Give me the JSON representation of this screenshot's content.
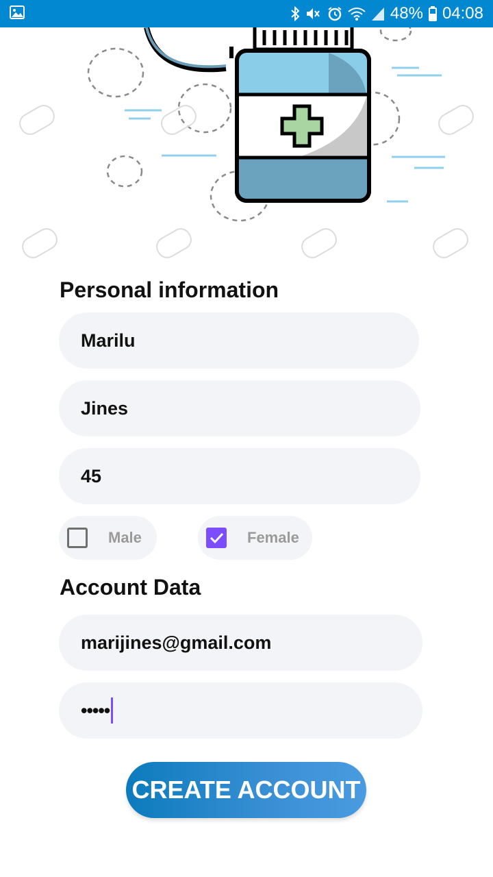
{
  "status_bar": {
    "battery_percent": "48%",
    "time": "04:08",
    "icons": [
      "image-icon",
      "bluetooth-icon",
      "mute-icon",
      "alarm-icon",
      "wifi-icon",
      "signal-icon",
      "battery-icon"
    ]
  },
  "colors": {
    "status_bar": "#0288d1",
    "field_bg": "#f3f4f8",
    "checkbox_accent": "#7c4dff",
    "button_gradient_start": "#0b7bbd",
    "button_gradient_end": "#4a9be0"
  },
  "hero": {
    "illustration": "medicine-bottle-illustration"
  },
  "personal": {
    "title": "Personal information",
    "first_name": "Marilu",
    "last_name": "Jines",
    "age": "45",
    "gender": {
      "male_label": "Male",
      "male_checked": false,
      "female_label": "Female",
      "female_checked": true
    }
  },
  "account": {
    "title": "Account Data",
    "email": "marijines@gmail.com",
    "password_mask": "•••••"
  },
  "actions": {
    "create_account_label": "CREATE ACCOUNT"
  }
}
